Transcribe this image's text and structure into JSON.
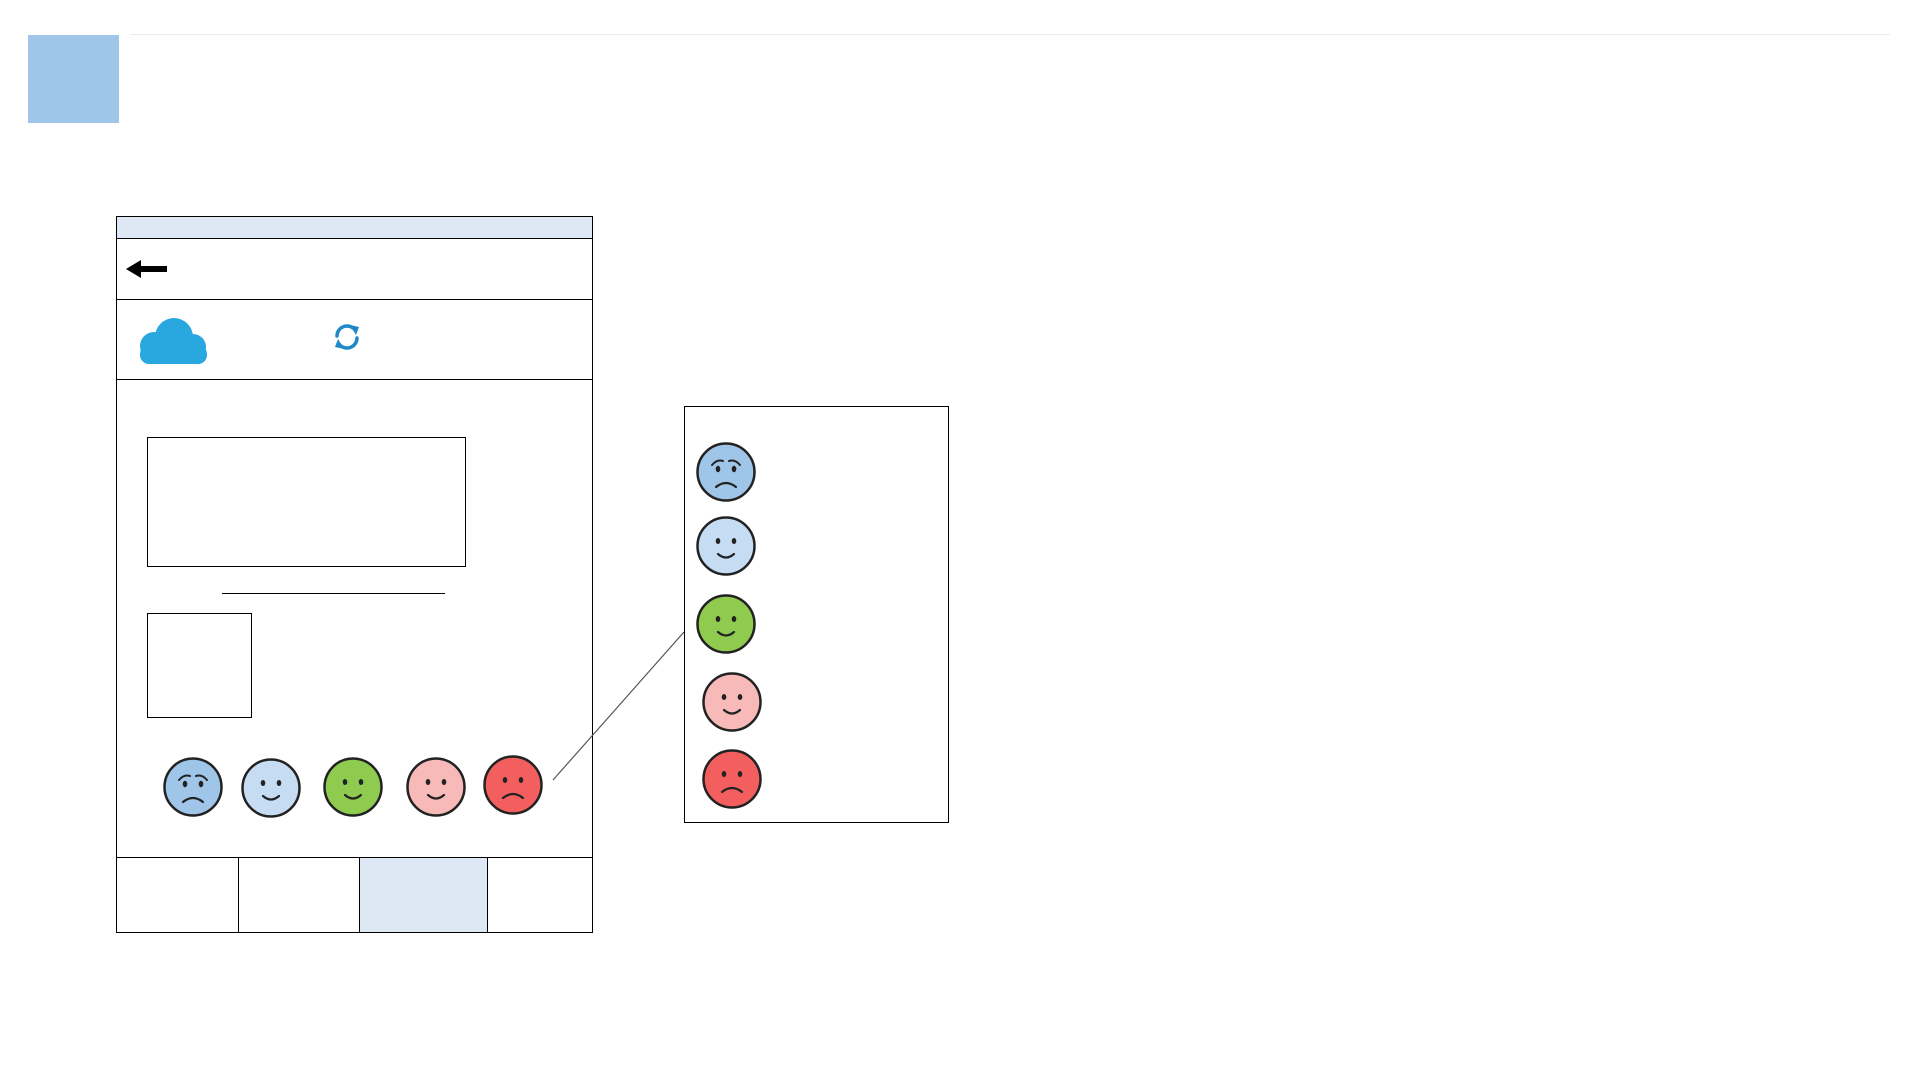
{
  "colors": {
    "corner_square": "#9fc5e8",
    "status_bar": "#dde8f4",
    "cloud": "#29a8e0",
    "refresh": "#1e88c8",
    "nav_active": "#dde8f4"
  },
  "phone": {
    "back_icon": "arrow-left-icon",
    "weather_icon": "cloud-icon",
    "refresh_icon": "refresh-icon",
    "nav_tabs": [
      {
        "active": false
      },
      {
        "active": false
      },
      {
        "active": true
      },
      {
        "active": false
      }
    ],
    "rating_faces": [
      {
        "icon": "worried-face-icon",
        "color": "#9fc5e8"
      },
      {
        "icon": "smiling-face-icon",
        "color": "#c6dcf2"
      },
      {
        "icon": "smiling-face-icon",
        "color": "#8ecb4f"
      },
      {
        "icon": "smiling-face-icon",
        "color": "#f8b9b9"
      },
      {
        "icon": "frowning-face-icon",
        "color": "#f35f5f"
      }
    ]
  },
  "legend": {
    "faces": [
      {
        "icon": "worried-face-icon",
        "color": "#9fc5e8"
      },
      {
        "icon": "smiling-face-icon",
        "color": "#c6dcf2"
      },
      {
        "icon": "smiling-face-icon",
        "color": "#8ecb4f"
      },
      {
        "icon": "smiling-face-icon",
        "color": "#f8b9b9"
      },
      {
        "icon": "frowning-face-icon",
        "color": "#f35f5f"
      }
    ]
  }
}
